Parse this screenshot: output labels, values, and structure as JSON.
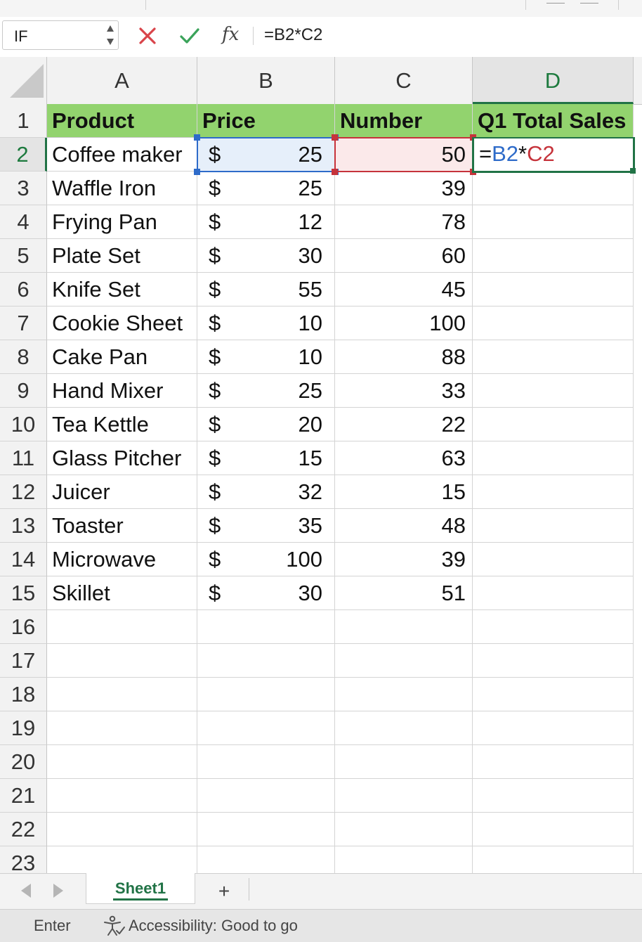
{
  "name_box": {
    "value": "IF"
  },
  "formula_bar": {
    "cancel_icon": "x-icon",
    "enter_icon": "check-icon",
    "fx_label": "fx",
    "formula": "=B2*C2"
  },
  "columns": [
    "A",
    "B",
    "C",
    "D"
  ],
  "active_column": "D",
  "active_row": 2,
  "header_row": {
    "row": "1",
    "cells": [
      "Product",
      "Price",
      "Number",
      "Q1 Total Sales"
    ],
    "fill_color": "#92d36e"
  },
  "rows": [
    {
      "row": "2",
      "product": "Coffee maker",
      "currency": "$",
      "price": "25",
      "number": "50"
    },
    {
      "row": "3",
      "product": "Waffle Iron",
      "currency": "$",
      "price": "25",
      "number": "39"
    },
    {
      "row": "4",
      "product": "Frying Pan",
      "currency": "$",
      "price": "12",
      "number": "78"
    },
    {
      "row": "5",
      "product": "Plate Set",
      "currency": "$",
      "price": "30",
      "number": "60"
    },
    {
      "row": "6",
      "product": "Knife Set",
      "currency": "$",
      "price": "55",
      "number": "45"
    },
    {
      "row": "7",
      "product": "Cookie Sheet",
      "currency": "$",
      "price": "10",
      "number": "100"
    },
    {
      "row": "8",
      "product": "Cake Pan",
      "currency": "$",
      "price": "10",
      "number": "88"
    },
    {
      "row": "9",
      "product": "Hand Mixer",
      "currency": "$",
      "price": "25",
      "number": "33"
    },
    {
      "row": "10",
      "product": "Tea Kettle",
      "currency": "$",
      "price": "20",
      "number": "22"
    },
    {
      "row": "11",
      "product": "Glass Pitcher",
      "currency": "$",
      "price": "15",
      "number": "63"
    },
    {
      "row": "12",
      "product": "Juicer",
      "currency": "$",
      "price": "32",
      "number": "15"
    },
    {
      "row": "13",
      "product": "Toaster",
      "currency": "$",
      "price": "35",
      "number": "48"
    },
    {
      "row": "14",
      "product": "Microwave",
      "currency": "$",
      "price": "100",
      "number": "39"
    },
    {
      "row": "15",
      "product": "Skillet",
      "currency": "$",
      "price": "30",
      "number": "51"
    }
  ],
  "empty_rows": [
    "16",
    "17",
    "18",
    "19",
    "20",
    "21",
    "22",
    "23"
  ],
  "editing_cell": {
    "ref": "D2",
    "parts": [
      "=",
      "B2",
      "*",
      "C2"
    ]
  },
  "colors": {
    "ref_b": "#2e6bc9",
    "ref_c": "#c6333b",
    "active_border": "#217346",
    "ref_b_fill": "#e6effa",
    "ref_c_fill": "#fbe9ea"
  },
  "sheet_tabs": {
    "prev_icon": "triangle-left-icon",
    "next_icon": "triangle-right-icon",
    "tabs": [
      "Sheet1"
    ],
    "add_label": "+"
  },
  "status_bar": {
    "mode": "Enter",
    "accessibility_icon": "accessibility-icon",
    "accessibility": "Accessibility: Good to go"
  }
}
